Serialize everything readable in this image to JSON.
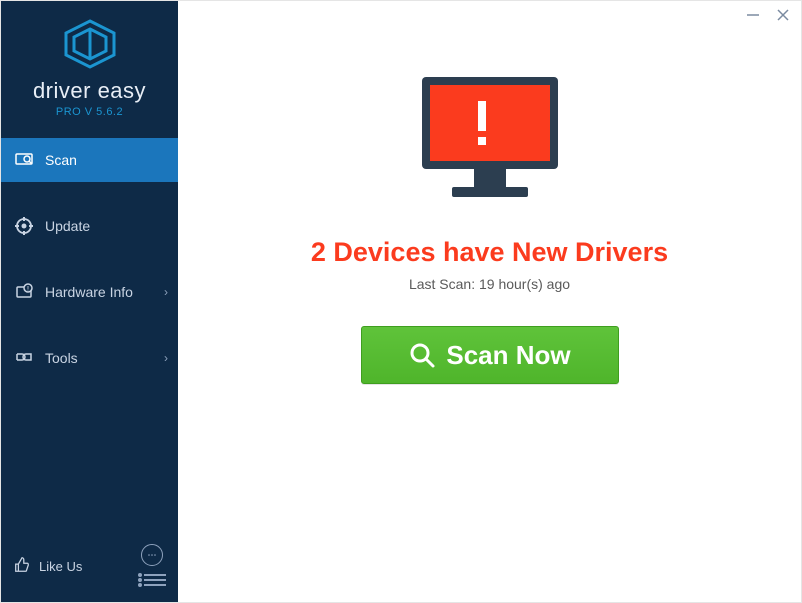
{
  "brand": {
    "name_bold": "driver",
    "name_thin": " easy",
    "version": "PRO V 5.6.2"
  },
  "sidebar": {
    "items": [
      {
        "label": "Scan"
      },
      {
        "label": "Update"
      },
      {
        "label": "Hardware Info"
      },
      {
        "label": "Tools"
      }
    ],
    "like_label": "Like Us"
  },
  "main": {
    "headline": "2 Devices have New Drivers",
    "last_scan": "Last Scan: 19 hour(s) ago",
    "scan_button": "Scan Now"
  }
}
